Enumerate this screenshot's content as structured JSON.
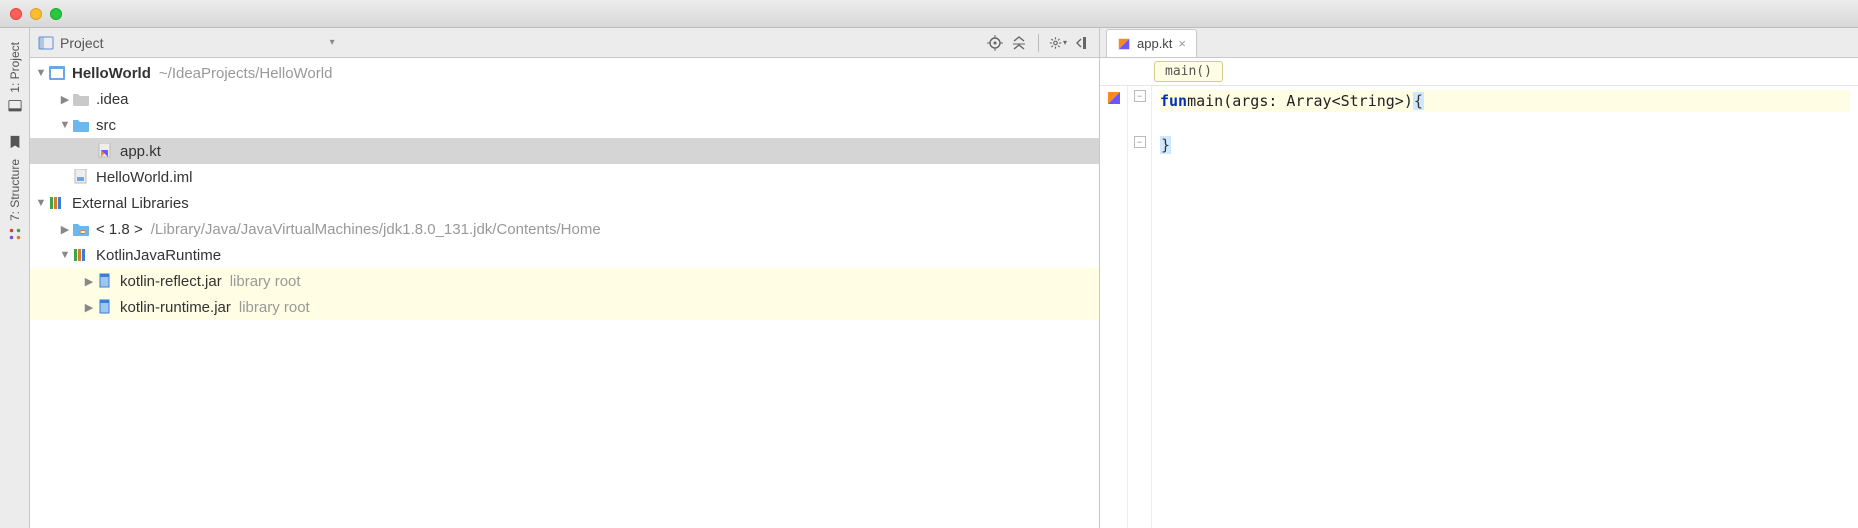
{
  "window": {
    "traffic": [
      "close",
      "minimize",
      "maximize"
    ]
  },
  "left_rail": {
    "items": [
      {
        "label": "1: Project"
      },
      {
        "label": "7: Structure"
      }
    ]
  },
  "panel": {
    "title": "Project"
  },
  "tree": {
    "root": {
      "label": "HelloWorld",
      "path": "~/IdeaProjects/HelloWorld"
    },
    "idea_dir": ".idea",
    "src_dir": "src",
    "app_file": "app.kt",
    "iml_file": "HelloWorld.iml",
    "ext_lib": "External Libraries",
    "jdk": {
      "label": "< 1.8 >",
      "path": "/Library/Java/JavaVirtualMachines/jdk1.8.0_131.jdk/Contents/Home"
    },
    "kotlin_rt": "KotlinJavaRuntime",
    "jars": [
      {
        "name": "kotlin-reflect.jar",
        "note": "library root"
      },
      {
        "name": "kotlin-runtime.jar",
        "note": "library root"
      }
    ]
  },
  "editor": {
    "tab": "app.kt",
    "crumb": "main()",
    "code": {
      "kw": "fun",
      "sig": " main(args: Array<String>) ",
      "open_brace": "{",
      "close_brace": "}"
    }
  }
}
